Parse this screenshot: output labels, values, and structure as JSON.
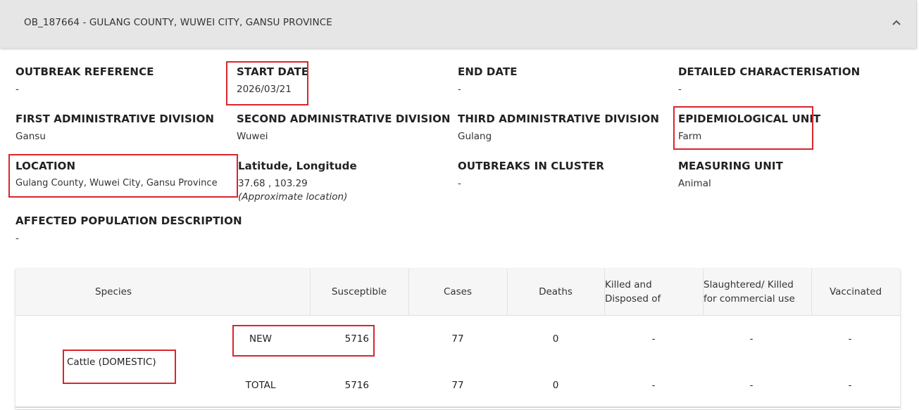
{
  "header": {
    "title": "OB_187664 - GULANG COUNTY, WUWEI CITY, GANSU PROVINCE",
    "collapse_icon": "chevron-up-icon"
  },
  "details": {
    "outbreak_reference": {
      "label": "OUTBREAK REFERENCE",
      "value": "-"
    },
    "start_date": {
      "label": "START DATE",
      "value": "2026/03/21"
    },
    "end_date": {
      "label": "END DATE",
      "value": "-"
    },
    "detailed_characterisation": {
      "label": "DETAILED CHARACTERISATION",
      "value": "-"
    },
    "first_admin_division": {
      "label": "FIRST ADMINISTRATIVE DIVISION",
      "value": "Gansu"
    },
    "second_admin_division": {
      "label": "SECOND ADMINISTRATIVE DIVISION",
      "value": "Wuwei"
    },
    "third_admin_division": {
      "label": "THIRD ADMINISTRATIVE DIVISION",
      "value": "Gulang"
    },
    "epidemiological_unit": {
      "label": "EPIDEMIOLOGICAL UNIT",
      "value": "Farm"
    },
    "location": {
      "label": "LOCATION",
      "value": "Gulang County, Wuwei City, Gansu Province"
    },
    "lat_long": {
      "label": "Latitude, Longitude",
      "value": "37.68 , 103.29",
      "note": "(Approximate location)"
    },
    "outbreaks_in_cluster": {
      "label": "OUTBREAKS IN CLUSTER",
      "value": "-"
    },
    "measuring_unit": {
      "label": "MEASURING UNIT",
      "value": "Animal"
    },
    "affected_population_description": {
      "label": "AFFECTED POPULATION DESCRIPTION",
      "value": "-"
    }
  },
  "table": {
    "headers": {
      "species": "Species",
      "susceptible": "Susceptible",
      "cases": "Cases",
      "deaths": "Deaths",
      "killed_disposed": "Killed and Disposed of",
      "slaughtered": "Slaughtered/ Killed for commercial use",
      "vaccinated": "Vaccinated"
    },
    "species": "Cattle (DOMESTIC)",
    "rows": [
      {
        "type": "NEW",
        "susceptible": "5716",
        "cases": "77",
        "deaths": "0",
        "killed_disposed": "-",
        "slaughtered": "-",
        "vaccinated": "-"
      },
      {
        "type": "TOTAL",
        "susceptible": "5716",
        "cases": "77",
        "deaths": "0",
        "killed_disposed": "-",
        "slaughtered": "-",
        "vaccinated": "-"
      }
    ]
  },
  "highlight_color": "#d8262c"
}
